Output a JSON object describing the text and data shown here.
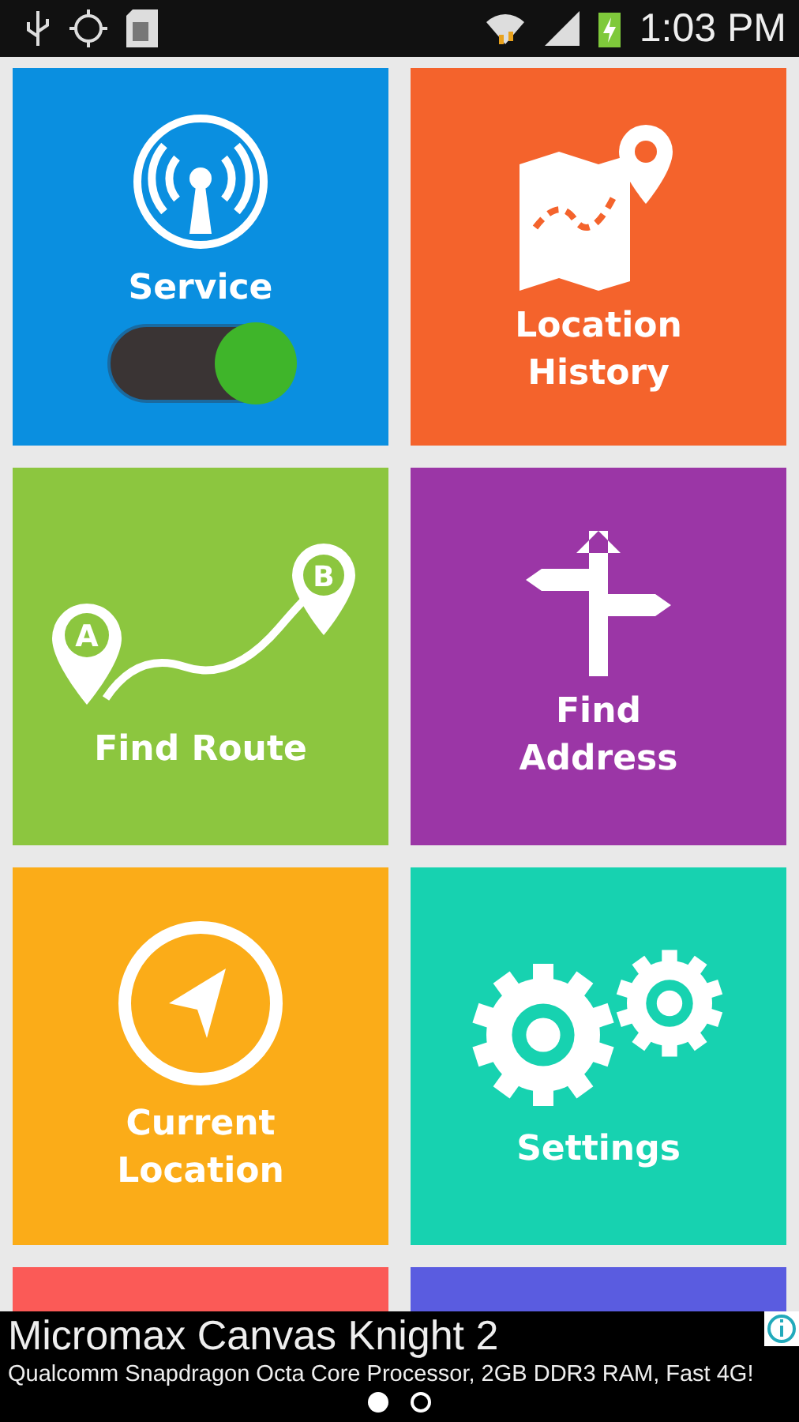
{
  "status_bar": {
    "time": "1:03 PM"
  },
  "tiles": [
    {
      "kind": "service",
      "label": "Service",
      "color": "#0a8fe0",
      "toggle": {
        "on": true
      }
    },
    {
      "kind": "history",
      "label": "Location History",
      "color": "#f4632c"
    },
    {
      "kind": "route",
      "label": "Find Route",
      "color": "#8cc63f",
      "markers": [
        "A",
        "B"
      ]
    },
    {
      "kind": "address",
      "label": "Find Address",
      "color": "#9b36a6"
    },
    {
      "kind": "current",
      "label": "Current Location",
      "color": "#fbac18"
    },
    {
      "kind": "settings",
      "label": "Settings",
      "color": "#17d2b0"
    },
    {
      "kind": "blank",
      "color": "#fb5a57"
    },
    {
      "kind": "blank",
      "color": "#5a5ce0"
    }
  ],
  "ad": {
    "title": "Micromax Canvas Knight 2",
    "text": "Qualcomm Snapdragon Octa Core Processor, 2GB DDR3 RAM, Fast 4G!",
    "pages": [
      {
        "selected": true
      },
      {
        "selected": false
      }
    ]
  }
}
